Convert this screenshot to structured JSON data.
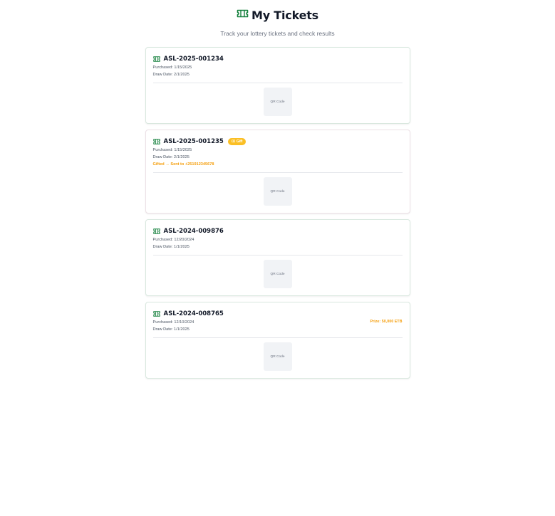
{
  "header": {
    "title": "My Tickets",
    "subtitle": "Track your lottery tickets and check results",
    "icon": "ticket-icon"
  },
  "colors": {
    "brand": "#15803d",
    "accent": "#fbbf24",
    "prize": "#f59e0b"
  },
  "tickets": [
    {
      "id": "ASL-2025-001234",
      "purchased": "Purchased: 1/15/2025",
      "draw_date": "Draw Date: 2/1/2025",
      "qr": "QR Code"
    },
    {
      "id": "ASL-2025-001235",
      "badge": "Gift",
      "purchased": "Purchased: 1/15/2025",
      "draw_date": "Draw Date: 2/1/2025",
      "gift_note": "Gifted → Sent to +251912345678",
      "qr": "QR Code"
    },
    {
      "id": "ASL-2024-009876",
      "purchased": "Purchased: 12/20/2024",
      "draw_date": "Draw Date: 1/1/2025",
      "qr": "QR Code"
    },
    {
      "id": "ASL-2024-008765",
      "purchased": "Purchased: 12/10/2024",
      "draw_date": "Draw Date: 1/1/2025",
      "prize": "Prize: 50,000 ETB",
      "qr": "QR Code"
    }
  ]
}
